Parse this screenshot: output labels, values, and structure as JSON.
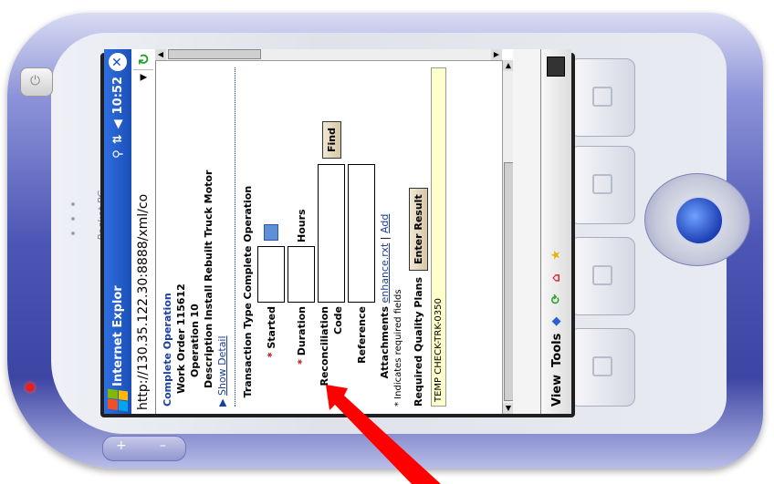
{
  "device": {
    "brand_text": "Pocket PC",
    "power_symbol": "⏻",
    "volume_plus": "+",
    "volume_minus": "–"
  },
  "titlebar": {
    "app_title": "Internet Explor",
    "time": "10:52",
    "close_label": "✕",
    "icons": [
      "connectivity-icon",
      "sync-icon",
      "speaker-icon"
    ]
  },
  "address_bar": {
    "url": "http://130.35.122.30:8888/xml/co",
    "dropdown": "▼",
    "refresh": "↻"
  },
  "page": {
    "heading": "Complete Operation",
    "work_order_label": "Work Order",
    "work_order_value": "115612",
    "operation_label": "Operation",
    "operation_value": "10",
    "description_label": "Description",
    "description_value": "Install Rebuilt Truck Motor",
    "show_detail": "Show Detail",
    "transaction_type_label": "Transaction Type",
    "transaction_type_value": "Complete Operation",
    "started_label": "Started",
    "duration_label": "Duration",
    "duration_unit": "Hours",
    "reconciliation_code_label": "Reconciliation Code",
    "find_button": "Find",
    "reference_label": "Reference",
    "attachments_label": "Attachments",
    "attachment_file": "enhance.rxt",
    "attachment_sep": "|",
    "add_link": "Add",
    "required_note": "* Indicates required fields",
    "quality_plans_label": "Required Quality Plans",
    "enter_result_button": "Enter Result",
    "quality_plan_item": "TEMP CHECK-TRK-0350",
    "required_marker": "*"
  },
  "bottombar": {
    "view_label": "View",
    "tools_label": "Tools"
  },
  "colors": {
    "title_blue": "#1b4fb8",
    "link_blue": "#1b3fa0",
    "device_purple": "#4d56b5",
    "arrow_red": "#ff0000"
  }
}
